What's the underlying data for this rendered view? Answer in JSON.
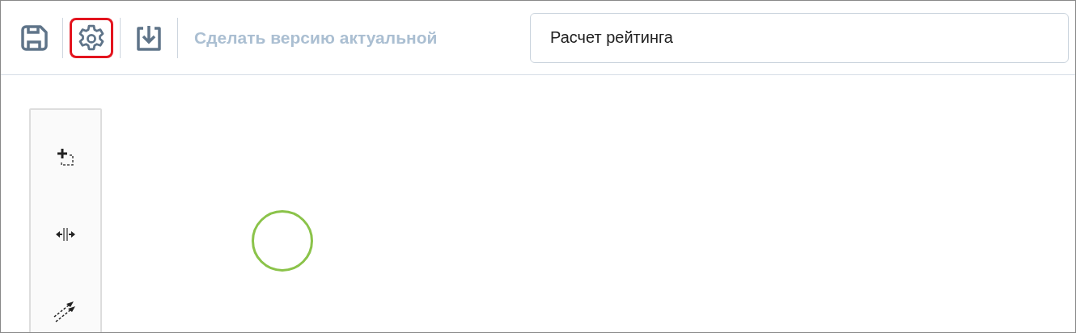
{
  "toolbar": {
    "buttons": [
      {
        "kind": "save",
        "highlighted": false
      },
      {
        "kind": "settings",
        "highlighted": true
      },
      {
        "kind": "import",
        "highlighted": false
      }
    ],
    "make_current": {
      "label": "Сделать версию актуальной",
      "disabled": true
    },
    "name_field": {
      "value": "Расчет рейтинга"
    }
  },
  "palette": {
    "tools": [
      {
        "kind": "lasso"
      },
      {
        "kind": "space"
      },
      {
        "kind": "connect"
      }
    ]
  },
  "canvas": {
    "elements": [
      {
        "kind": "start-event"
      }
    ]
  }
}
